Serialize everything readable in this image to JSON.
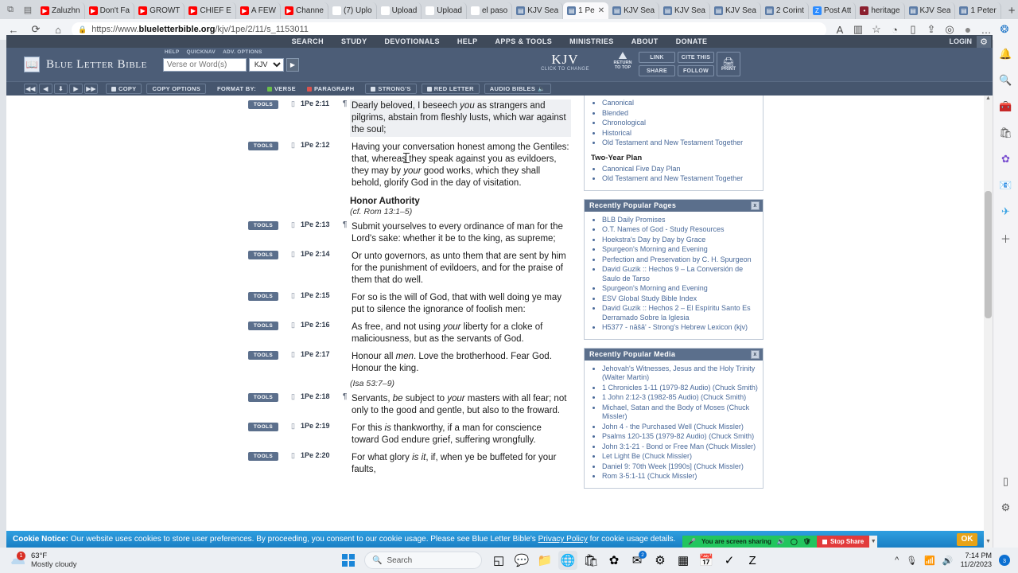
{
  "browser": {
    "tabs": [
      {
        "label": "Zaluzhn",
        "fav": "youtube-icon",
        "style": "fav-yt",
        "active": false
      },
      {
        "label": "Don't Fa",
        "fav": "youtube-icon",
        "style": "fav-yt",
        "active": false
      },
      {
        "label": "GROWT",
        "fav": "youtube-icon",
        "style": "fav-yt",
        "active": false
      },
      {
        "label": "CHIEF E",
        "fav": "youtube-icon",
        "style": "fav-yt",
        "active": false
      },
      {
        "label": "A FEW",
        "fav": "youtube-icon",
        "style": "fav-yt",
        "active": false
      },
      {
        "label": "Channe",
        "fav": "youtube-icon",
        "style": "fav-yt",
        "active": false
      },
      {
        "label": "(7) Uplo",
        "fav": "photos-icon",
        "style": "fav-red",
        "active": false
      },
      {
        "label": "Upload",
        "fav": "play-icon",
        "style": "fav-up",
        "active": false
      },
      {
        "label": "Upload",
        "fav": "refresh-icon",
        "style": "fav-red",
        "active": false
      },
      {
        "label": "el paso",
        "fav": "globe-icon",
        "style": "fav-orange",
        "active": false
      },
      {
        "label": "KJV Sea",
        "fav": "blb-icon",
        "style": "fav-blb",
        "active": false
      },
      {
        "label": "1 Pe",
        "fav": "blb-icon",
        "style": "fav-blb",
        "active": true
      },
      {
        "label": "KJV Sea",
        "fav": "blb-icon",
        "style": "fav-blb",
        "active": false
      },
      {
        "label": "KJV Sea",
        "fav": "blb-icon",
        "style": "fav-blb",
        "active": false
      },
      {
        "label": "KJV Sea",
        "fav": "blb-icon",
        "style": "fav-blb",
        "active": false
      },
      {
        "label": "2 Corint",
        "fav": "blb-icon",
        "style": "fav-blb",
        "active": false
      },
      {
        "label": "Post Att",
        "fav": "zoom-icon",
        "style": "fav-zoom",
        "active": false
      },
      {
        "label": "heritage",
        "fav": "heritage-icon",
        "style": "fav-her",
        "active": false
      },
      {
        "label": "KJV Sea",
        "fav": "blb-icon",
        "style": "fav-blb",
        "active": false
      },
      {
        "label": "1 Peter",
        "fav": "blb-icon",
        "style": "fav-blb",
        "active": false
      }
    ],
    "new_tab_label": "+",
    "window_controls": [
      "—",
      "▢",
      "✕"
    ],
    "url_prefix": "https://www.",
    "url_domain": "blueletterbible.org",
    "url_path": "/kjv/1pe/2/11/s_1153011",
    "nav_back": "←",
    "nav_refresh": "⟳",
    "nav_home": "⌂",
    "lock_icon": "🔒",
    "toolbar_right": [
      "A",
      "▥",
      "☆",
      "◑",
      "▯",
      "⇪",
      "◎",
      "●",
      "…"
    ],
    "sidebar_icons": [
      "bell-icon",
      "search-icon",
      "toolbox-icon",
      "shopping-icon",
      "copilot-icon",
      "outlook-icon",
      "telegram-icon",
      "add-icon"
    ]
  },
  "site": {
    "topnav": [
      "SEARCH",
      "STUDY",
      "DEVOTIONALS",
      "HELP",
      "APPS & TOOLS",
      "MINISTRIES",
      "ABOUT",
      "DONATE"
    ],
    "login": "LOGIN",
    "gear": "⚙",
    "brand": "Blue Letter Bible",
    "search_links": [
      "HELP",
      "QUICKNAV",
      "ADV. OPTIONS"
    ],
    "search_placeholder": "Verse or Word(s)",
    "version_selected": "KJV",
    "go": "▶",
    "translation_big": "KJV",
    "translation_sub": "CLICK TO CHANGE",
    "return_to_top_1": "RETURN",
    "return_to_top_2": "TO TOP",
    "mini_buttons": [
      "LINK",
      "CITE THIS",
      "SHARE",
      "FOLLOW"
    ],
    "print_label": "PRINT",
    "toolbar": {
      "arrows": [
        "◀◀",
        "◀",
        "⬇",
        "▶",
        "▶▶"
      ],
      "copy": "COPY",
      "copy_options": "COPY OPTIONS",
      "format_by": "FORMAT BY:",
      "verse": "VERSE",
      "paragraph": "PARAGRAPH",
      "strongs": "STRONG'S",
      "red_letter": "RED LETTER",
      "audio_bibles": "AUDIO BIBLES"
    }
  },
  "verses": [
    {
      "tools": "TOOLS",
      "book": "1Pe",
      "ref": "2:11",
      "pilcrow": "¶",
      "highlight": true,
      "parts": [
        {
          "t": "Dearly beloved, I beseech ",
          "i": false
        },
        {
          "t": "you",
          "i": true
        },
        {
          "t": " as strangers and pilgrims, abstain from fleshly lusts, which war against the soul;",
          "i": false
        }
      ]
    },
    {
      "tools": "TOOLS",
      "book": "1Pe",
      "ref": "2:12",
      "pilcrow": "",
      "highlight": false,
      "parts": [
        {
          "t": "Having your conversation honest among the Gentiles: that, whereas they speak against you as evildoers, they may by ",
          "i": false
        },
        {
          "t": "your",
          "i": true
        },
        {
          "t": " good works, which they shall behold, glorify God in the day of visitation.",
          "i": false
        }
      ]
    },
    {
      "tools": "TOOLS",
      "book": "1Pe",
      "ref": "2:13",
      "pilcrow": "¶",
      "highlight": false,
      "parts": [
        {
          "t": "Submit yourselves to every ordinance of man for the Lord's sake: whether it be to the king, as supreme;",
          "i": false
        }
      ]
    },
    {
      "tools": "TOOLS",
      "book": "1Pe",
      "ref": "2:14",
      "pilcrow": "",
      "highlight": false,
      "parts": [
        {
          "t": "Or unto governors, as unto them that are sent by him for the punishment of evildoers, and for the praise of them that do well.",
          "i": false
        }
      ]
    },
    {
      "tools": "TOOLS",
      "book": "1Pe",
      "ref": "2:15",
      "pilcrow": "",
      "highlight": false,
      "parts": [
        {
          "t": "For so is the will of God, that with well doing ye may put to silence the ignorance of foolish men:",
          "i": false
        }
      ]
    },
    {
      "tools": "TOOLS",
      "book": "1Pe",
      "ref": "2:16",
      "pilcrow": "",
      "highlight": false,
      "parts": [
        {
          "t": "As free, and not using ",
          "i": false
        },
        {
          "t": "your",
          "i": true
        },
        {
          "t": " liberty for a cloke of maliciousness, but as the servants of God.",
          "i": false
        }
      ]
    },
    {
      "tools": "TOOLS",
      "book": "1Pe",
      "ref": "2:17",
      "pilcrow": "",
      "highlight": false,
      "parts": [
        {
          "t": "Honour all ",
          "i": false
        },
        {
          "t": "men",
          "i": true
        },
        {
          "t": ". Love the brotherhood. Fear God. Honour the king.",
          "i": false
        }
      ]
    },
    {
      "tools": "TOOLS",
      "book": "1Pe",
      "ref": "2:18",
      "pilcrow": "¶",
      "highlight": false,
      "parts": [
        {
          "t": "Servants, ",
          "i": false
        },
        {
          "t": "be",
          "i": true
        },
        {
          "t": " subject to ",
          "i": false
        },
        {
          "t": "your",
          "i": true
        },
        {
          "t": " masters with all fear; not only to the good and gentle, but also to the froward.",
          "i": false
        }
      ]
    },
    {
      "tools": "TOOLS",
      "book": "1Pe",
      "ref": "2:19",
      "pilcrow": "",
      "highlight": false,
      "parts": [
        {
          "t": "For this ",
          "i": false
        },
        {
          "t": "is",
          "i": true
        },
        {
          "t": " thankworthy, if a man for conscience toward God endure grief, suffering wrongfully.",
          "i": false
        }
      ]
    },
    {
      "tools": "TOOLS",
      "book": "1Pe",
      "ref": "2:20",
      "pilcrow": "",
      "highlight": false,
      "parts": [
        {
          "t": "For what glory ",
          "i": false
        },
        {
          "t": "is it",
          "i": true
        },
        {
          "t": ", if, when ye be buffeted for your faults,",
          "i": false
        }
      ]
    }
  ],
  "section_heading": {
    "title": "Honor Authority",
    "cf_prefix": "cf.",
    "cf_ref": "Rom 13:1–5"
  },
  "cross_ref": {
    "ref": "Isa 53:7–9"
  },
  "sidebar": {
    "one_year_items": [
      "Canonical",
      "Blended",
      "Chronological",
      "Historical",
      "Old Testament and New Testament Together"
    ],
    "two_year_title": "Two-Year Plan",
    "two_year_items": [
      "Canonical Five Day Plan",
      "Old Testament and New Testament Together"
    ],
    "popular_pages": {
      "title": "Recently Popular Pages",
      "close": "x",
      "items": [
        "BLB Daily Promises",
        "O.T. Names of God - Study Resources",
        "Hoekstra's Day by Day by Grace",
        "Spurgeon's Morning and Evening",
        "Perfection and Preservation by C. H. Spurgeon",
        "David Guzik :: Hechos 9 – La Conversión de Saulo de Tarso",
        "Spurgeon's Morning and Evening",
        "ESV Global Study Bible Index",
        "David Guzik :: Hechos 2 – El Espíritu Santo Es Derramado Sobre la Iglesia",
        "H5377 - nāšā' - Strong's Hebrew Lexicon (kjv)"
      ]
    },
    "popular_media": {
      "title": "Recently Popular Media",
      "close": "x",
      "items": [
        "Jehovah's Witnesses, Jesus and the Holy Trinity (Walter Martin)",
        "1 Chronicles 1-11 (1979-82 Audio) (Chuck Smith)",
        "1 John 2:12-3 (1982-85 Audio) (Chuck Smith)",
        "Michael, Satan and the Body of Moses (Chuck Missler)",
        "John 4 - the Purchased Well (Chuck Missler)",
        "Psalms 120-135 (1979-82 Audio) (Chuck Smith)",
        "John 3:1-21 - Bond or Free Man (Chuck Missler)",
        "Let Light Be (Chuck Missler)",
        "Daniel 9: 70th Week [1990s] (Chuck Missler)",
        "Rom 3-5:1-11 (Chuck Missler)"
      ]
    }
  },
  "cookie_notice": {
    "bold": "Cookie Notice:",
    "text1": " Our website uses cookies to store user preferences. By proceeding, you consent to our cookie usage. Please see Blue Letter Bible's ",
    "link": "Privacy Policy",
    "text2": " for cookie usage details.",
    "ok": "OK"
  },
  "screen_share": {
    "label": "You are screen sharing",
    "stop": "Stop Share",
    "mic": "🎤",
    "icons": [
      "🔊",
      "◯",
      "🛡"
    ]
  },
  "taskbar": {
    "weather_temp": "63°F",
    "weather_desc": "Mostly cloudy",
    "weather_badge": "1",
    "search_placeholder": "Search",
    "search_icon": "search-icon",
    "apps": [
      {
        "name": "task-view-icon",
        "glyph": "◱",
        "badge": "",
        "active": false
      },
      {
        "name": "chat-icon",
        "glyph": "💬",
        "badge": "",
        "active": false
      },
      {
        "name": "file-explorer-icon",
        "glyph": "📁",
        "badge": "",
        "active": false
      },
      {
        "name": "edge-icon",
        "glyph": "🌐",
        "badge": "",
        "active": true
      },
      {
        "name": "store-icon",
        "glyph": "🛍",
        "badge": "",
        "active": false
      },
      {
        "name": "office-icon",
        "glyph": "✿",
        "badge": "",
        "active": false
      },
      {
        "name": "mail-icon",
        "glyph": "✉",
        "badge": "2",
        "active": false
      },
      {
        "name": "settings-icon",
        "glyph": "⚙",
        "badge": "",
        "active": false
      },
      {
        "name": "calculator-icon",
        "glyph": "▦",
        "badge": "",
        "active": false
      },
      {
        "name": "calendar-icon",
        "glyph": "📅",
        "badge": "",
        "active": false
      },
      {
        "name": "todo-icon",
        "glyph": "✓",
        "badge": "",
        "active": false
      },
      {
        "name": "zoom-icon",
        "glyph": "Z",
        "badge": "",
        "active": false
      }
    ],
    "tray": [
      "^",
      "🎙",
      "📶",
      "🔊"
    ],
    "time": "7:14 PM",
    "date": "11/2/2023",
    "notif_count": "3"
  },
  "colors": {
    "blb_navy": "#4c5d77",
    "blb_dark": "#3f4a5a",
    "blb_button": "#5b6f8c",
    "link_blue": "#4a6a9a",
    "cookie_blue": "#1a7fc4",
    "ok_orange": "#e8a317",
    "share_green": "#22c55e",
    "stop_red": "#e23b3b"
  }
}
